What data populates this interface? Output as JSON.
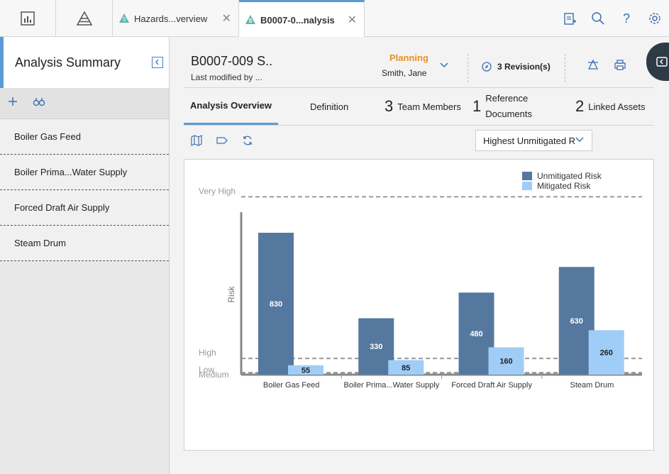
{
  "tabs": [
    {
      "label": "Hazards...verview",
      "active": false
    },
    {
      "label": "B0007-0...nalysis",
      "active": true
    }
  ],
  "sidebar": {
    "title": "Analysis Summary",
    "items": [
      {
        "label": "Boiler Gas Feed"
      },
      {
        "label": "Boiler Prima...Water Supply"
      },
      {
        "label": "Forced Draft Air Supply"
      },
      {
        "label": "Steam Drum"
      }
    ]
  },
  "header": {
    "title": "B0007-009 S..",
    "subtitle": "Last modified by ...",
    "state": "Planning",
    "state_owner": "Smith, Jane",
    "revisions": "3 Revision(s)"
  },
  "analysis_tabs": [
    {
      "num": "",
      "label": "Analysis Overview",
      "active": true
    },
    {
      "num": "",
      "label": "Definition",
      "active": false
    },
    {
      "num": "3",
      "label": "Team Members",
      "active": false
    },
    {
      "num": "1",
      "label_line1": "Reference",
      "label_line2": "Documents",
      "active": false
    },
    {
      "num": "2",
      "label": "Linked Assets",
      "active": false
    }
  ],
  "chart_controls": {
    "dropdown_value": "Highest Unmitigated R"
  },
  "colors": {
    "accent": "#5b9bd5",
    "unmitigated": "#55789f",
    "mitigated": "#9fcdf7",
    "state": "#e8912a"
  },
  "chart_data": {
    "type": "bar",
    "categories": [
      "Boiler Gas Feed",
      "Boiler Prima...Water Supply",
      "Forced Draft Air Supply",
      "Steam Drum"
    ],
    "series": [
      {
        "name": "Unmitigated Risk",
        "values": [
          830,
          330,
          480,
          630
        ]
      },
      {
        "name": "Mitigated Risk",
        "values": [
          55,
          85,
          160,
          260
        ]
      }
    ],
    "ylabel": "Risk",
    "ylim": [
      0,
      1050
    ],
    "thresholds": [
      {
        "label": "Very High",
        "value": 1040
      },
      {
        "label": "High",
        "value": 95
      },
      {
        "label": "Medium",
        "value": 12
      },
      {
        "label": "Low",
        "value": 5
      }
    ],
    "legend": "top-right"
  }
}
